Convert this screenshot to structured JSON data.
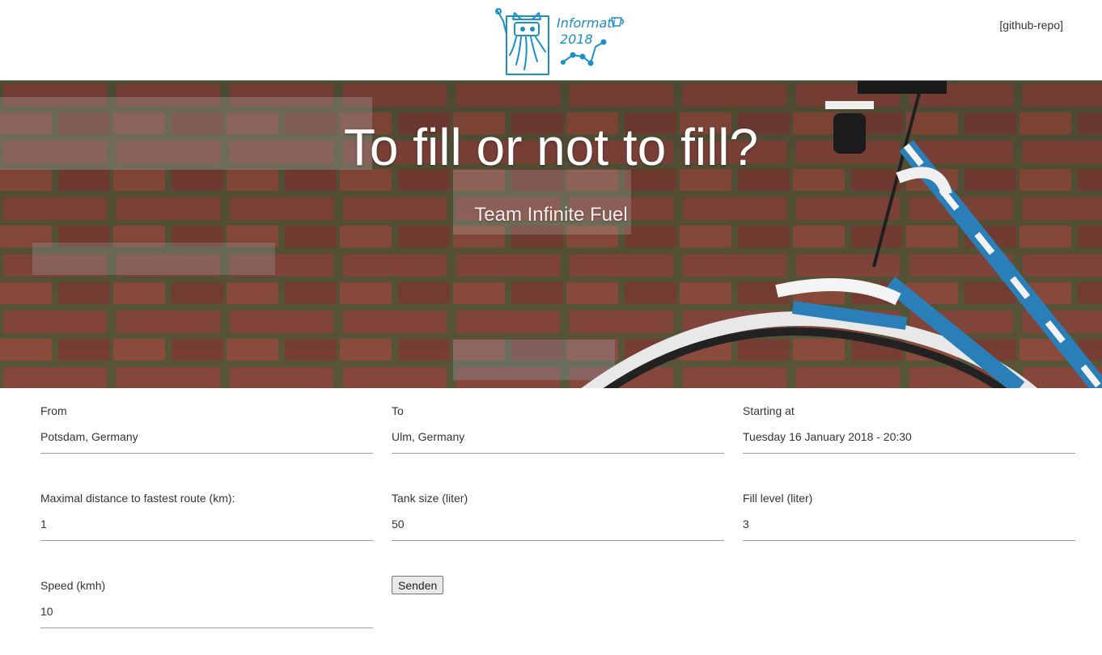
{
  "header": {
    "logo_text_line1": "Informati",
    "logo_text_line2": "2018",
    "repo_link": "[github-repo]"
  },
  "hero": {
    "title": "To fill or not to fill?",
    "subtitle": "Team Infinite Fuel"
  },
  "form": {
    "from_label": "From",
    "from_value": "Potsdam, Germany",
    "to_label": "To",
    "to_value": "Ulm, Germany",
    "start_label": "Starting at",
    "start_value": "Tuesday 16 January 2018 - 20:30",
    "distance_label": "Maximal distance to fastest route (km):",
    "distance_value": "1",
    "tank_label": "Tank size (liter)",
    "tank_value": "50",
    "fill_label": "Fill level (liter)",
    "fill_value": "3",
    "speed_label": "Speed (kmh)",
    "speed_value": "10",
    "submit_label": "Senden"
  },
  "colors": {
    "logo_blue": "#1a8fc9",
    "bike_blue": "#2b7fb8",
    "brick": "#8a4a3c"
  }
}
